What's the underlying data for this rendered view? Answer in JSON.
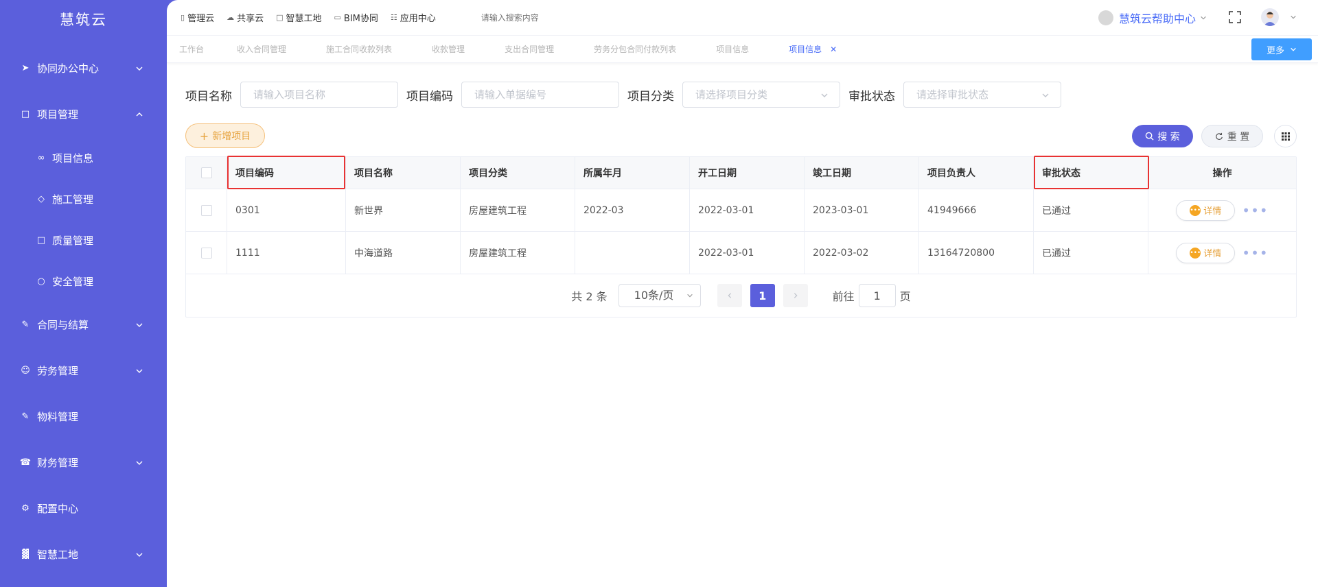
{
  "sidebar": {
    "logo": "慧筑云",
    "items": [
      {
        "label": "协同办公中心"
      },
      {
        "label": "项目管理"
      },
      {
        "label": "项目信息"
      },
      {
        "label": "施工管理"
      },
      {
        "label": "质量管理"
      },
      {
        "label": "安全管理"
      },
      {
        "label": "合同与结算"
      },
      {
        "label": "劳务管理"
      },
      {
        "label": "物料管理"
      },
      {
        "label": "财务管理"
      },
      {
        "label": "配置中心"
      },
      {
        "label": "智慧工地"
      }
    ]
  },
  "topbar": {
    "links": [
      "管理云",
      "共享云",
      "智慧工地",
      "BIM协同",
      "应用中心"
    ],
    "search_placeholder": "请输入搜索内容",
    "help": "慧筑云帮助中心"
  },
  "tabs": [
    "工作台",
    "收入合同管理",
    "施工合同收款列表",
    "收款管理",
    "支出合同管理",
    "劳务分包合同付款列表",
    "项目信息",
    "项目信息"
  ],
  "more_button": "更多",
  "filters": {
    "name_label": "项目名称",
    "name_placeholder": "请输入项目名称",
    "code_label": "项目编码",
    "code_placeholder": "请输入单据编号",
    "category_label": "项目分类",
    "category_placeholder": "请选择项目分类",
    "status_label": "审批状态",
    "status_placeholder": "请选择审批状态"
  },
  "actions": {
    "add": "新增项目",
    "search": "搜 索",
    "reset": "重 置"
  },
  "table": {
    "columns": [
      "项目编码",
      "项目名称",
      "项目分类",
      "所属年月",
      "开工日期",
      "竣工日期",
      "项目负责人",
      "审批状态",
      "操作"
    ],
    "rows": [
      [
        "0301",
        "新世界",
        "房屋建筑工程",
        "2022-03",
        "2022-03-01",
        "2023-03-01",
        "41949666",
        "已通过"
      ],
      [
        "1111",
        "中海道路",
        "房屋建筑工程",
        "",
        "2022-03-01",
        "2022-03-02",
        "13164720800",
        "已通过"
      ]
    ],
    "detail_label": "详情"
  },
  "pagination": {
    "total": "共 2 条",
    "page_size": "10条/页",
    "current": "1",
    "goto_label": "前往",
    "goto_value": "1",
    "page_suffix": "页"
  },
  "colors": {
    "primary": "#5b5fdc",
    "accent": "#4a6cf7",
    "highlight": "#e83232",
    "warning": "#e6a23c"
  }
}
